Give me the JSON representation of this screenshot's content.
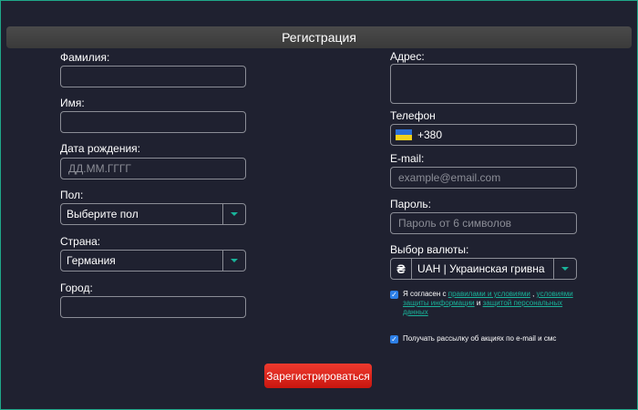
{
  "title": "Регистрация",
  "left": {
    "surname_label": "Фамилия:",
    "name_label": "Имя:",
    "birth_label": "Дата рождения:",
    "birth_placeholder": "ДД.ММ.ГГГГ",
    "gender_label": "Пол:",
    "gender_value": "Выберите пол",
    "country_label": "Страна:",
    "country_value": "Германия",
    "city_label": "Город:"
  },
  "right": {
    "address_label": "Адрес:",
    "phone_label": "Телефон",
    "phone_code": "+380",
    "email_label": "E-mail:",
    "email_placeholder": "example@email.com",
    "password_label": "Пароль:",
    "password_placeholder": "Пароль от 6 символов",
    "currency_label": "Выбор валюты:",
    "currency_symbol": "₴",
    "currency_value": "UAH | Украинская гривна"
  },
  "agree": {
    "prefix": "Я согласен с",
    "link_rules": "правилами и условиями",
    "sep": ",",
    "link_privacy": "условиями защиты информации",
    "and": "и",
    "link_personal": "защитой персональных данных"
  },
  "newsletter": "Получать рассылку об акциях по e-mail и смс",
  "submit_label": "Зарегистрироваться",
  "colors": {
    "background": "#1f2130",
    "accent": "#19b39a",
    "checkbox": "#2d7fe6",
    "submit": "#e02a1f"
  }
}
